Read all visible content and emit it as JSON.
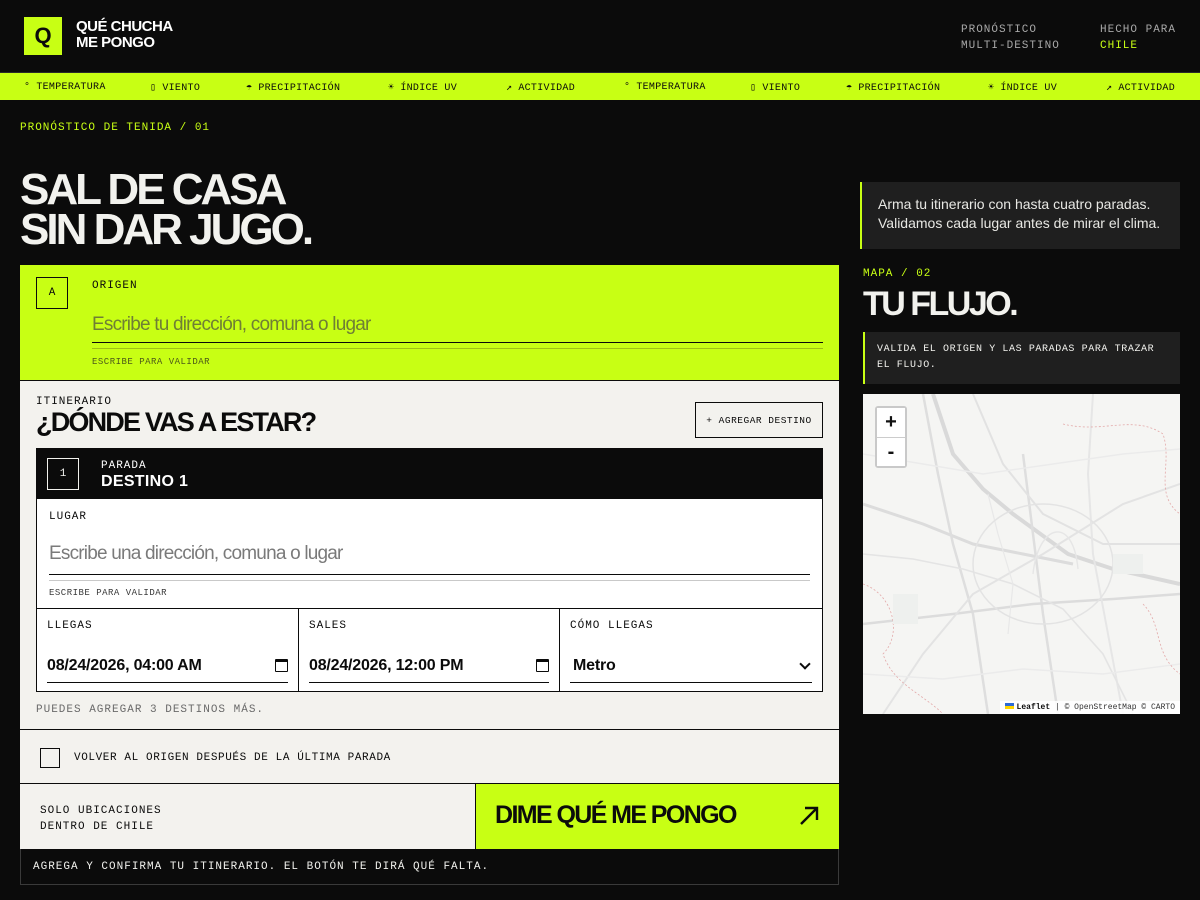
{
  "brand": {
    "logo_letter": "Q",
    "name_line1": "QUÉ CHUCHA",
    "name_line2": "ME PONGO"
  },
  "header": {
    "meta1_line1": "PRONÓSTICO",
    "meta1_line2": "MULTI-DESTINO",
    "meta2_line1": "HECHO PARA",
    "meta2_line2": "CHILE"
  },
  "ticker": [
    {
      "icon": "°",
      "label": "TEMPERATURA"
    },
    {
      "icon": "▯",
      "label": "VIENTO"
    },
    {
      "icon": "☂",
      "label": "PRECIPITACIÓN"
    },
    {
      "icon": "☀",
      "label": "ÍNDICE UV"
    },
    {
      "icon": "↗",
      "label": "ACTIVIDAD"
    },
    {
      "icon": "°",
      "label": "TEMPERATURA"
    },
    {
      "icon": "▯",
      "label": "VIENTO"
    },
    {
      "icon": "☂",
      "label": "PRECIPITACIÓN"
    },
    {
      "icon": "☀",
      "label": "ÍNDICE UV"
    },
    {
      "icon": "↗",
      "label": "ACTIVIDAD"
    }
  ],
  "main": {
    "section_label": "PRONÓSTICO DE TENIDA / 01",
    "hero_line1": "SAL DE CASA",
    "hero_line2": "SIN DAR JUGO."
  },
  "origin": {
    "badge": "A",
    "label": "ORIGEN",
    "placeholder": "Escribe tu dirección, comuna o lugar",
    "hint": "ESCRIBE PARA VALIDAR"
  },
  "itinerary": {
    "small_label": "ITINERARIO",
    "title": "¿DÓNDE VAS A ESTAR?",
    "add_label": "+ AGREGAR DESTINO",
    "stop": {
      "badge": "1",
      "kicker": "PARADA",
      "name": "DESTINO 1",
      "place_label": "LUGAR",
      "place_placeholder": "Escribe una dirección, comuna o lugar",
      "hint": "ESCRIBE PARA VALIDAR",
      "arrive_label": "LLEGAS",
      "arrive_value": "08/24/2026, 04:00 AM",
      "leave_label": "SALES",
      "leave_value": "08/24/2026, 12:00 PM",
      "mode_label": "CÓMO LLEGAS",
      "mode_value": "Metro"
    },
    "more_note": "PUEDES AGREGAR 3 DESTINOS MÁS."
  },
  "return_label": "VOLVER AL ORIGEN DESPUÉS DE LA ÚLTIMA PARADA",
  "submit": {
    "note_line1": "SOLO UBICACIONES",
    "note_line2": "DENTRO DE CHILE",
    "cta": "DIME QUÉ ME PONGO"
  },
  "status": "AGREGA Y CONFIRMA TU ITINERARIO. EL BOTÓN TE DIRÁ QUÉ FALTA.",
  "sidebar": {
    "callout": "Arma tu itinerario con hasta cuatro paradas. Validamos cada lugar antes de mirar el clima.",
    "map_label": "MAPA / 02",
    "map_title": "TU FLUJO.",
    "map_note": "VALIDA EL ORIGEN Y LAS PARADAS PARA TRAZAR EL FLUJO.",
    "zoom_in": "+",
    "zoom_out": "-",
    "attrib_leaflet": "Leaflet",
    "attrib_rest": "| © OpenStreetMap © CARTO"
  },
  "colors": {
    "accent": "#c8ff14",
    "background": "#0b0b0b",
    "paper": "#f3f2ee"
  }
}
